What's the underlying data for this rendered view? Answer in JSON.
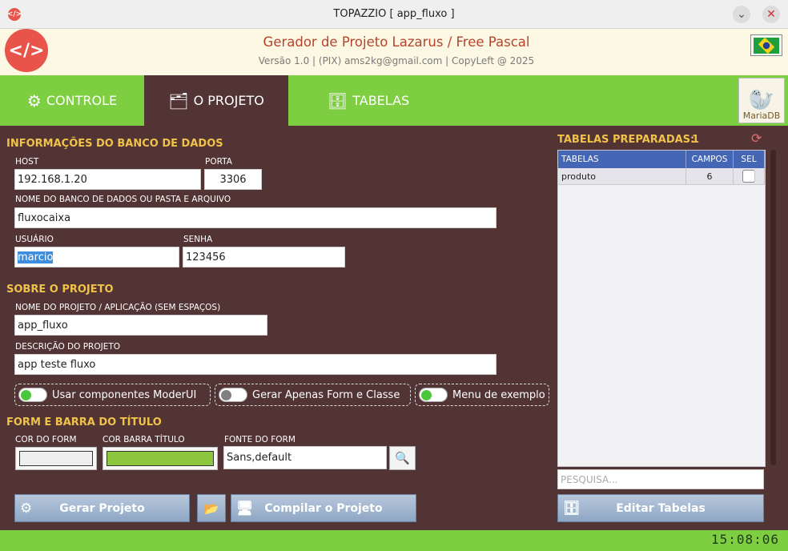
{
  "window": {
    "title": "TOPAZZIO [ app_fluxo ]",
    "icon": "code-icon"
  },
  "header": {
    "title": "Gerador de Projeto Lazarus / Free Pascal",
    "subtitle": "Versão 1.0 | (PIX) ams2kg@gmail.com | CopyLeft @ 2025",
    "logo_text": "</>",
    "flag": "brazil-flag-icon"
  },
  "tabs": [
    {
      "label": "CONTROLE",
      "icon": "gears-icon",
      "active": false
    },
    {
      "label": "O PROJETO",
      "icon": "project-icon",
      "active": true
    },
    {
      "label": "TABELAS",
      "icon": "database-icon",
      "active": false
    }
  ],
  "db_logo": {
    "text": "MariaDB"
  },
  "db_info": {
    "heading": "INFORMAÇÕES DO BANCO DE DADOS",
    "host_label": "HOST",
    "host_value": "192.168.1.20",
    "port_label": "PORTA",
    "port_value": "3306",
    "dbname_label": "NOME DO BANCO DE DADOS OU PASTA E ARQUIVO",
    "dbname_value": "fluxocaixa",
    "user_label": "USUÁRIO",
    "user_value": "marcio",
    "password_label": "SENHA",
    "password_value": "123456"
  },
  "project": {
    "heading": "SOBRE O PROJETO",
    "name_label": "NOME DO PROJETO / APLICAÇÃO (SEM ESPAÇOS)",
    "name_value": "app_fluxo",
    "desc_label": "DESCRIÇÃO DO PROJETO",
    "desc_value": "app teste fluxo"
  },
  "toggles": [
    {
      "label": "Usar componentes ModerUI",
      "on": true
    },
    {
      "label": "Gerar Apenas Form e Classe",
      "on": false
    },
    {
      "label": "Menu de exemplo",
      "on": true
    }
  ],
  "form": {
    "heading": "FORM E BARRA DO TÍTULO",
    "form_color_label": "COR DO FORM",
    "form_color": "#efefef",
    "title_color_label": "COR BARRA TÍTULO",
    "title_color": "#8dc63f",
    "font_label": "FONTE DO FORM",
    "font_value": "Sans,default"
  },
  "buttons": {
    "generate": "Gerar Projeto",
    "compile": "Compilar o Projeto",
    "edit_tables": "Editar Tabelas"
  },
  "tables_panel": {
    "heading": "TABELAS PREPARADAS:",
    "count": "1",
    "columns": [
      "TABELAS",
      "CAMPOS",
      "SEL"
    ],
    "rows": [
      {
        "name": "produto",
        "fields": "6",
        "selected": false
      }
    ],
    "search_placeholder": "PESQUISA..."
  },
  "footer": {
    "clock": "15:08:06"
  }
}
